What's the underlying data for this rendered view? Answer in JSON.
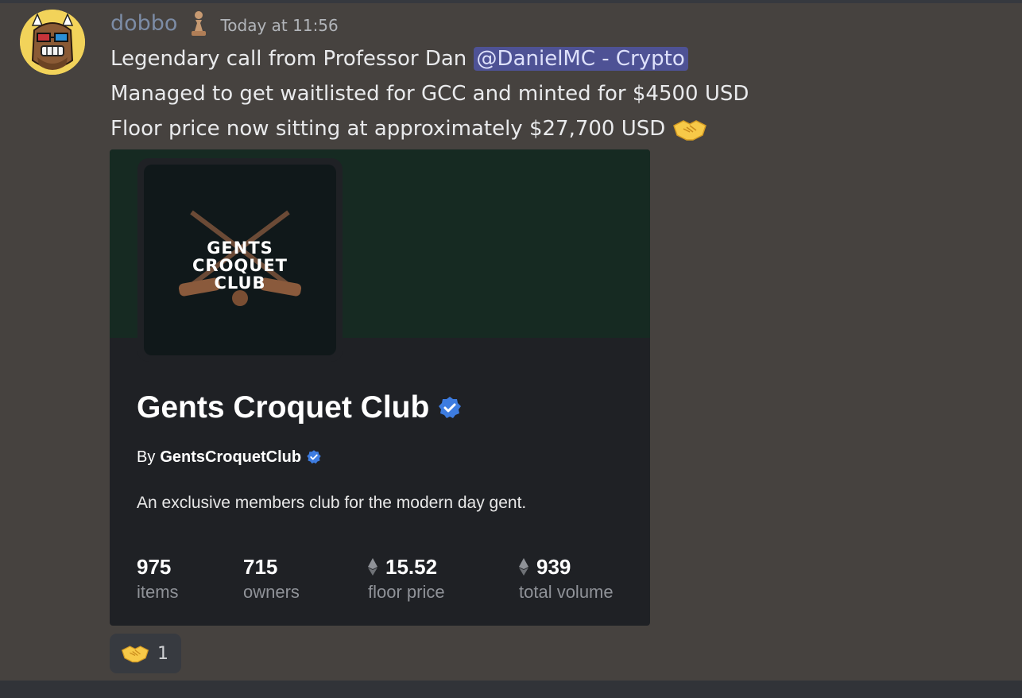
{
  "message": {
    "username": "dobbo",
    "timestamp": "Today at 11:56",
    "line1_prefix": "Legendary call from Professor Dan ",
    "mention": "@DanielMC - Crypto",
    "line2": "Managed to get waitlisted for GCC and minted for $4500 USD",
    "line3": "Floor price now sitting at approximately $27,700 USD ",
    "emoji": "handshake-emoji"
  },
  "embed": {
    "logo_text": [
      "GENTS",
      "CROQUET",
      "CLUB"
    ],
    "title": "Gents Croquet Club",
    "by_prefix": "By",
    "creator": "GentsCroquetClub",
    "description": "An exclusive members club for the modern day gent.",
    "stats": [
      {
        "value": "975",
        "label": "items",
        "eth": false
      },
      {
        "value": "715",
        "label": "owners",
        "eth": false
      },
      {
        "value": "15.52",
        "label": "floor price",
        "eth": true
      },
      {
        "value": "939",
        "label": "total volume",
        "eth": true
      }
    ]
  },
  "reaction": {
    "emoji": "handshake-emoji",
    "count": "1"
  },
  "colors": {
    "background": "#46423f",
    "username": "#7c8ca6",
    "mention_bg": "#4e5295",
    "embed_bg": "#1f2125",
    "banner_bg": "#162a22",
    "verified": "#3d7ce0"
  }
}
